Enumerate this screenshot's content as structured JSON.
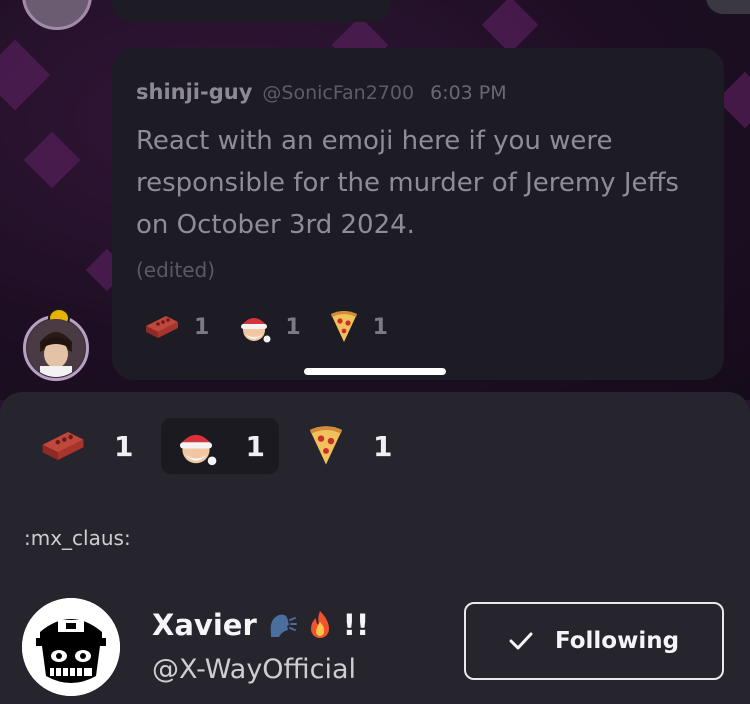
{
  "message": {
    "author": "shinji-guy",
    "handle": "@SonicFan2700",
    "time": "6:03 PM",
    "text": "React with an emoji here if you were responsible for the murder of Jeremy Jeffs on October 3rd 2024.",
    "edited_label": "(edited)",
    "reactions": [
      {
        "icon": "brick-icon",
        "count": "1"
      },
      {
        "icon": "santa-claus-icon",
        "count": "1"
      },
      {
        "icon": "pizza-icon",
        "count": "1"
      }
    ]
  },
  "sheet": {
    "reactions": [
      {
        "icon": "brick-icon",
        "count": "1",
        "selected": false
      },
      {
        "icon": "santa-claus-icon",
        "count": "1",
        "selected": true
      },
      {
        "icon": "pizza-icon",
        "count": "1",
        "selected": false
      }
    ],
    "emoji_name": ":mx_claus:",
    "user": {
      "name": "Xavier",
      "name_suffix": "!!",
      "name_icons": [
        "speaking-head-icon",
        "fire-icon"
      ],
      "handle": "@X-WayOfficial"
    },
    "follow_button": {
      "label": "Following",
      "icon": "checkmark-icon"
    }
  },
  "colors": {
    "sheet_bg": "#26252d",
    "message_bg": "#1d1b24",
    "background": "#2b1431"
  }
}
